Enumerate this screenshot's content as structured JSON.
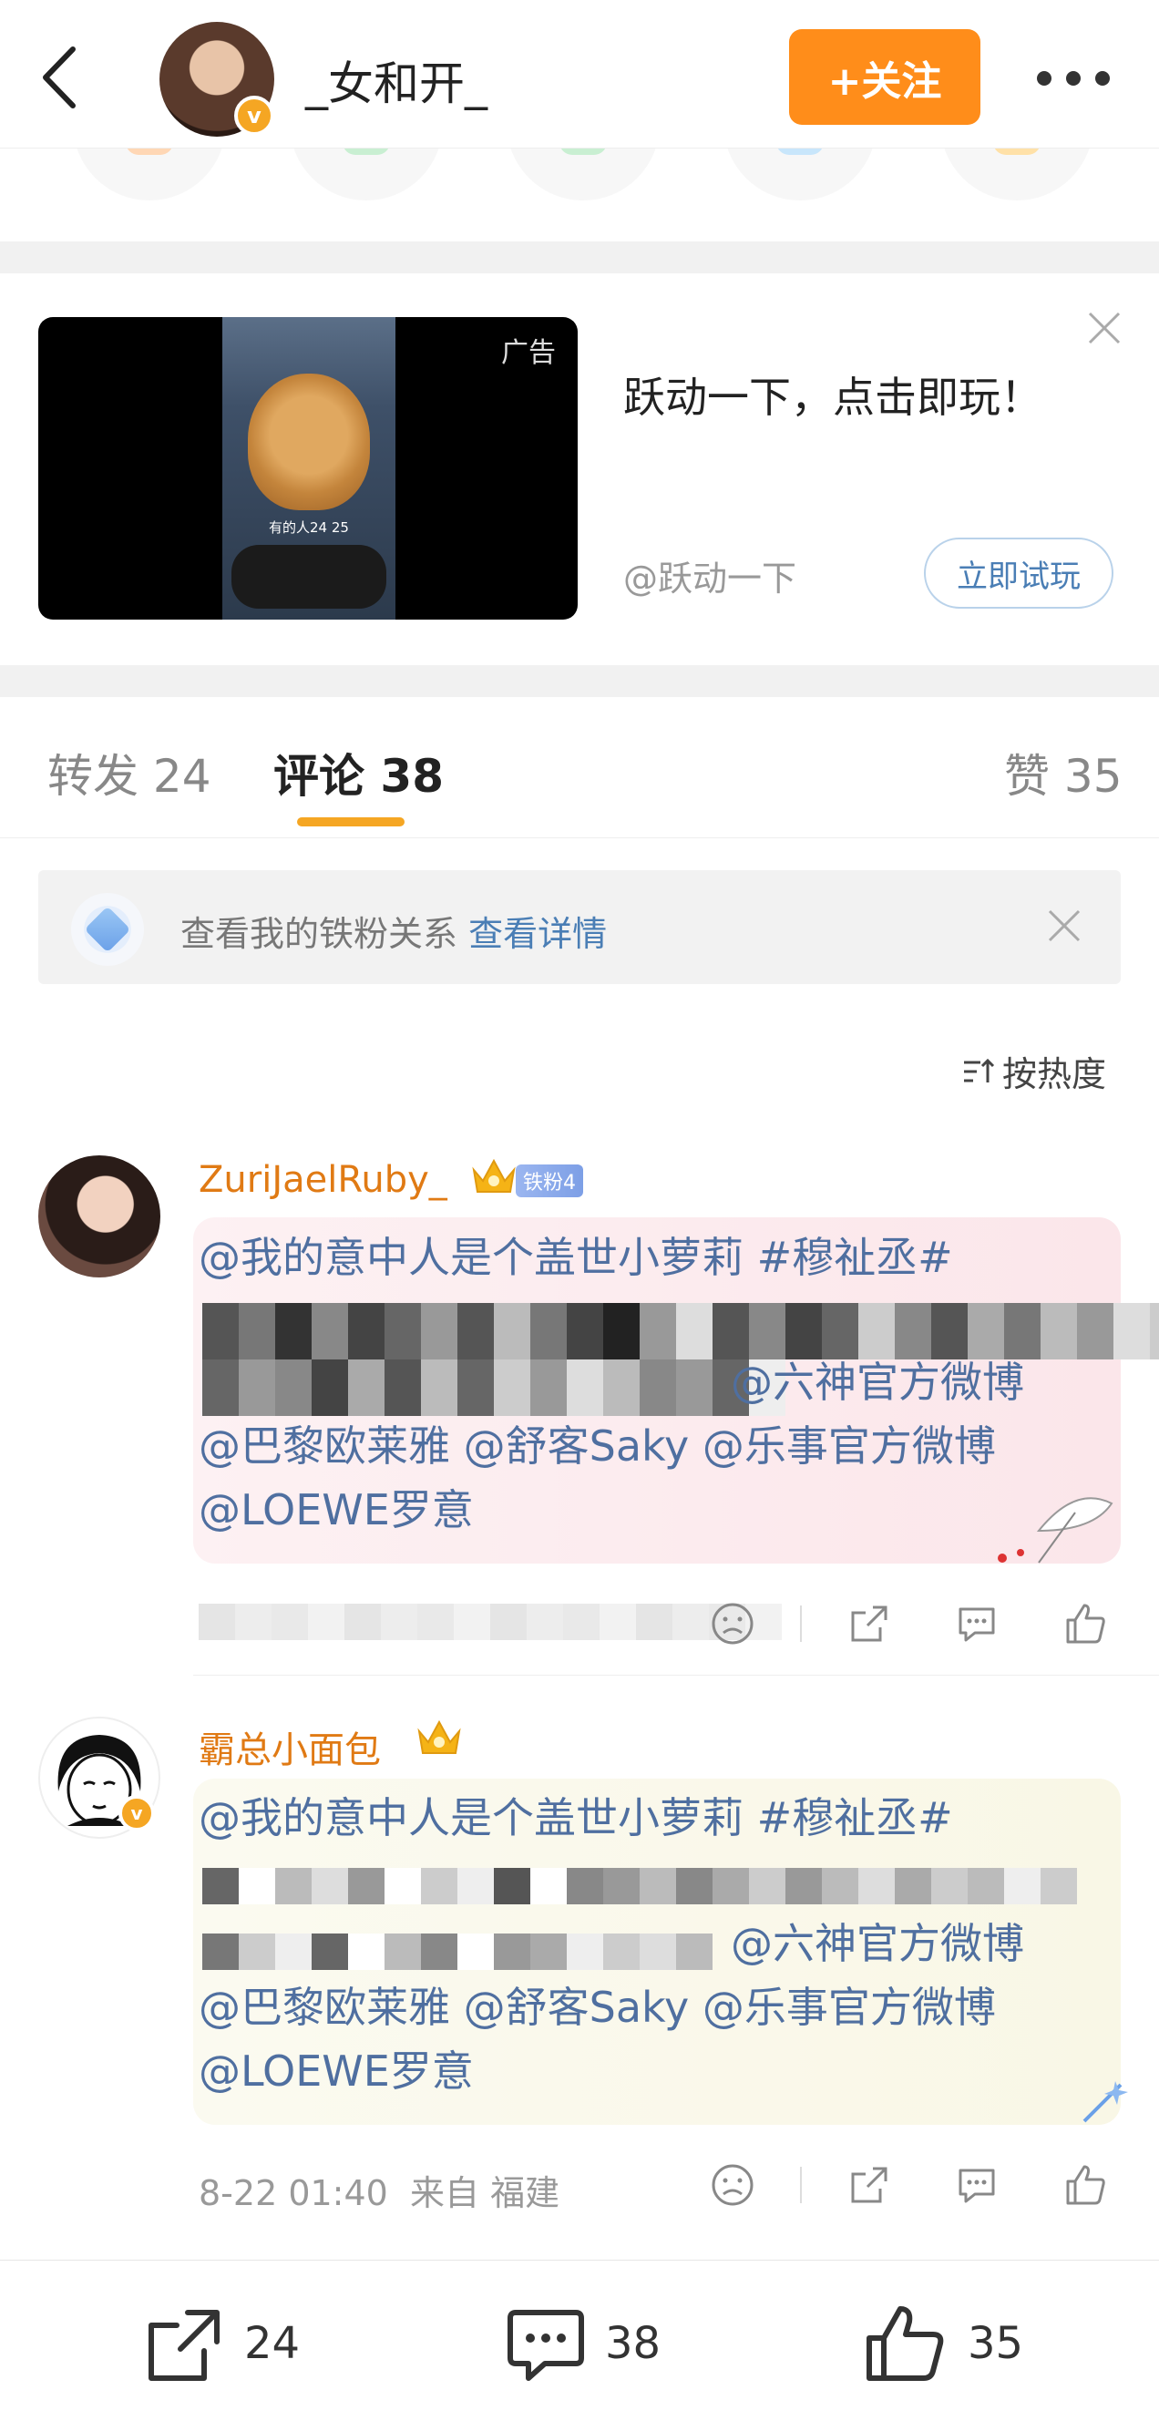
{
  "header": {
    "username": "_女和开_",
    "follow_label": "+关注",
    "verified_mark": "v"
  },
  "share_row": {
    "icons": [
      "share-orange-icon",
      "wechat-icon",
      "moments-icon",
      "weibo-icon",
      "more-share-icon"
    ]
  },
  "ad": {
    "tag": "广告",
    "caption": "有的人24 25",
    "title": "跃动一下，点击即玩！",
    "source": "@跃动一下",
    "cta": "立即试玩"
  },
  "tabs": {
    "repost": "转发 24",
    "comment": "评论 38",
    "like": "赞 35"
  },
  "ironfan": {
    "text": "查看我的铁粉关系",
    "link": "查看详情"
  },
  "sort_label": "按热度",
  "comments": [
    {
      "name": "ZuriJaelRuby_",
      "fan_badge": "铁粉4",
      "lines": [
        "@我的意中人是个盖世小萝莉 #穆祉丞#",
        "@六神官方微博",
        "@巴黎欧莱雅 @舒客Saky @乐事官方微博",
        "@LOEWE罗意"
      ]
    },
    {
      "name": "霸总小面包",
      "lines": [
        "@我的意中人是个盖世小萝莉 #穆祉丞#",
        "@六神官方微博",
        "@巴黎欧莱雅 @舒客Saky @乐事官方微博",
        "@LOEWE罗意"
      ],
      "time": "8-22 01:40",
      "location": "来自 福建"
    }
  ],
  "bottom_bar": {
    "repost_count": "24",
    "comment_count": "38",
    "like_count": "35"
  },
  "colors": {
    "accent": "#ff8d1a",
    "link": "#4f6fa0",
    "name": "#e07a14",
    "tab_indicator": "#f5a623"
  }
}
